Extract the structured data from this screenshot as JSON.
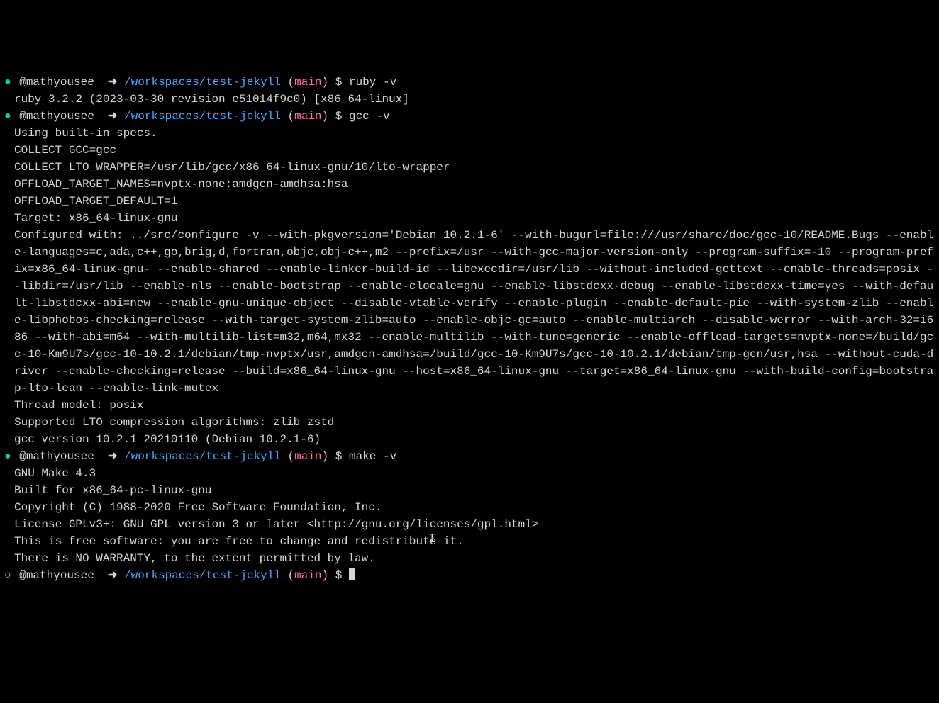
{
  "prompts": [
    {
      "bullet_class": "bullet",
      "bullet": "●",
      "user": "@mathyousee",
      "arrow": "➜",
      "path": "/workspaces/test-jekyll",
      "branch_open": "(",
      "branch": "main",
      "branch_close": ")",
      "dollar": "$",
      "command": "ruby -v"
    },
    {
      "bullet_class": "bullet",
      "bullet": "●",
      "user": "@mathyousee",
      "arrow": "➜",
      "path": "/workspaces/test-jekyll",
      "branch_open": "(",
      "branch": "main",
      "branch_close": ")",
      "dollar": "$",
      "command": "gcc -v"
    },
    {
      "bullet_class": "bullet",
      "bullet": "●",
      "user": "@mathyousee",
      "arrow": "➜",
      "path": "/workspaces/test-jekyll",
      "branch_open": "(",
      "branch": "main",
      "branch_close": ")",
      "dollar": "$",
      "command": "make -v"
    },
    {
      "bullet_class": "bullet-hollow",
      "bullet": "○",
      "user": "@mathyousee",
      "arrow": "➜",
      "path": "/workspaces/test-jekyll",
      "branch_open": "(",
      "branch": "main",
      "branch_close": ")",
      "dollar": "$",
      "command": ""
    }
  ],
  "output_ruby": "ruby 3.2.2 (2023-03-30 revision e51014f9c0) [x86_64-linux]",
  "output_gcc": {
    "line1": "Using built-in specs.",
    "line2": "COLLECT_GCC=gcc",
    "line3": "COLLECT_LTO_WRAPPER=/usr/lib/gcc/x86_64-linux-gnu/10/lto-wrapper",
    "line4": "OFFLOAD_TARGET_NAMES=nvptx-none:amdgcn-amdhsa:hsa",
    "line5": "OFFLOAD_TARGET_DEFAULT=1",
    "line6": "Target: x86_64-linux-gnu",
    "line7": "Configured with: ../src/configure -v --with-pkgversion='Debian 10.2.1-6' --with-bugurl=file:///usr/share/doc/gcc-10/README.Bugs --enable-languages=c,ada,c++,go,brig,d,fortran,objc,obj-c++,m2 --prefix=/usr --with-gcc-major-version-only --program-suffix=-10 --program-prefix=x86_64-linux-gnu- --enable-shared --enable-linker-build-id --libexecdir=/usr/lib --without-included-gettext --enable-threads=posix --libdir=/usr/lib --enable-nls --enable-bootstrap --enable-clocale=gnu --enable-libstdcxx-debug --enable-libstdcxx-time=yes --with-default-libstdcxx-abi=new --enable-gnu-unique-object --disable-vtable-verify --enable-plugin --enable-default-pie --with-system-zlib --enable-libphobos-checking=release --with-target-system-zlib=auto --enable-objc-gc=auto --enable-multiarch --disable-werror --with-arch-32=i686 --with-abi=m64 --with-multilib-list=m32,m64,mx32 --enable-multilib --with-tune=generic --enable-offload-targets=nvptx-none=/build/gcc-10-Km9U7s/gcc-10-10.2.1/debian/tmp-nvptx/usr,amdgcn-amdhsa=/build/gcc-10-Km9U7s/gcc-10-10.2.1/debian/tmp-gcn/usr,hsa --without-cuda-driver --enable-checking=release --build=x86_64-linux-gnu --host=x86_64-linux-gnu --target=x86_64-linux-gnu --with-build-config=bootstrap-lto-lean --enable-link-mutex",
    "line8": "Thread model: posix",
    "line9": "Supported LTO compression algorithms: zlib zstd",
    "line10": "gcc version 10.2.1 20210110 (Debian 10.2.1-6)"
  },
  "output_make": {
    "line1": "GNU Make 4.3",
    "line2": "Built for x86_64-pc-linux-gnu",
    "line3": "Copyright (C) 1988-2020 Free Software Foundation, Inc.",
    "line4": "License GPLv3+: GNU GPL version 3 or later <http://gnu.org/licenses/gpl.html>",
    "line5": "This is free software: you are free to change and redistribute it.",
    "line6": "There is NO WARRANTY, to the extent permitted by law."
  }
}
